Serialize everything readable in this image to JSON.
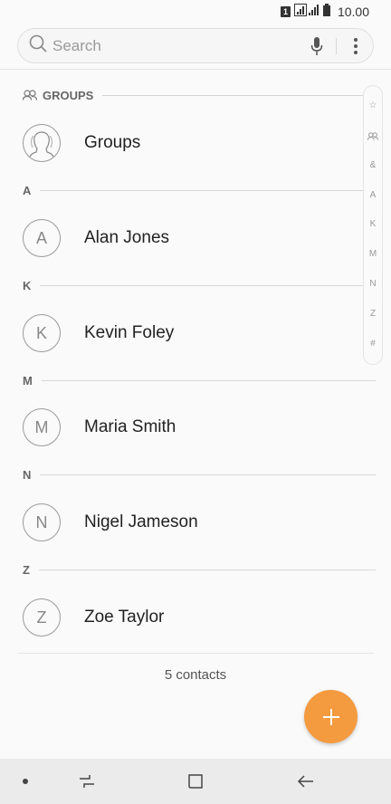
{
  "status_bar": {
    "sim": "1",
    "time": "10.00"
  },
  "search": {
    "placeholder": "Search"
  },
  "sections": {
    "groups": "GROUPS",
    "a": "A",
    "k": "K",
    "m": "M",
    "n": "N",
    "z": "Z"
  },
  "contacts": [
    {
      "name": "Groups",
      "initial": ""
    },
    {
      "name": "Alan Jones",
      "initial": "A"
    },
    {
      "name": "Kevin Foley",
      "initial": "K"
    },
    {
      "name": "Maria Smith",
      "initial": "M"
    },
    {
      "name": "Nigel Jameson",
      "initial": "N"
    },
    {
      "name": "Zoe Taylor",
      "initial": "Z"
    }
  ],
  "index_bar": [
    "☆",
    "&",
    "A",
    "K",
    "M",
    "N",
    "Z",
    "#"
  ],
  "footer": {
    "count": "5 contacts"
  },
  "colors": {
    "fab": "#f49a3f",
    "navbar": "#ebebeb"
  }
}
